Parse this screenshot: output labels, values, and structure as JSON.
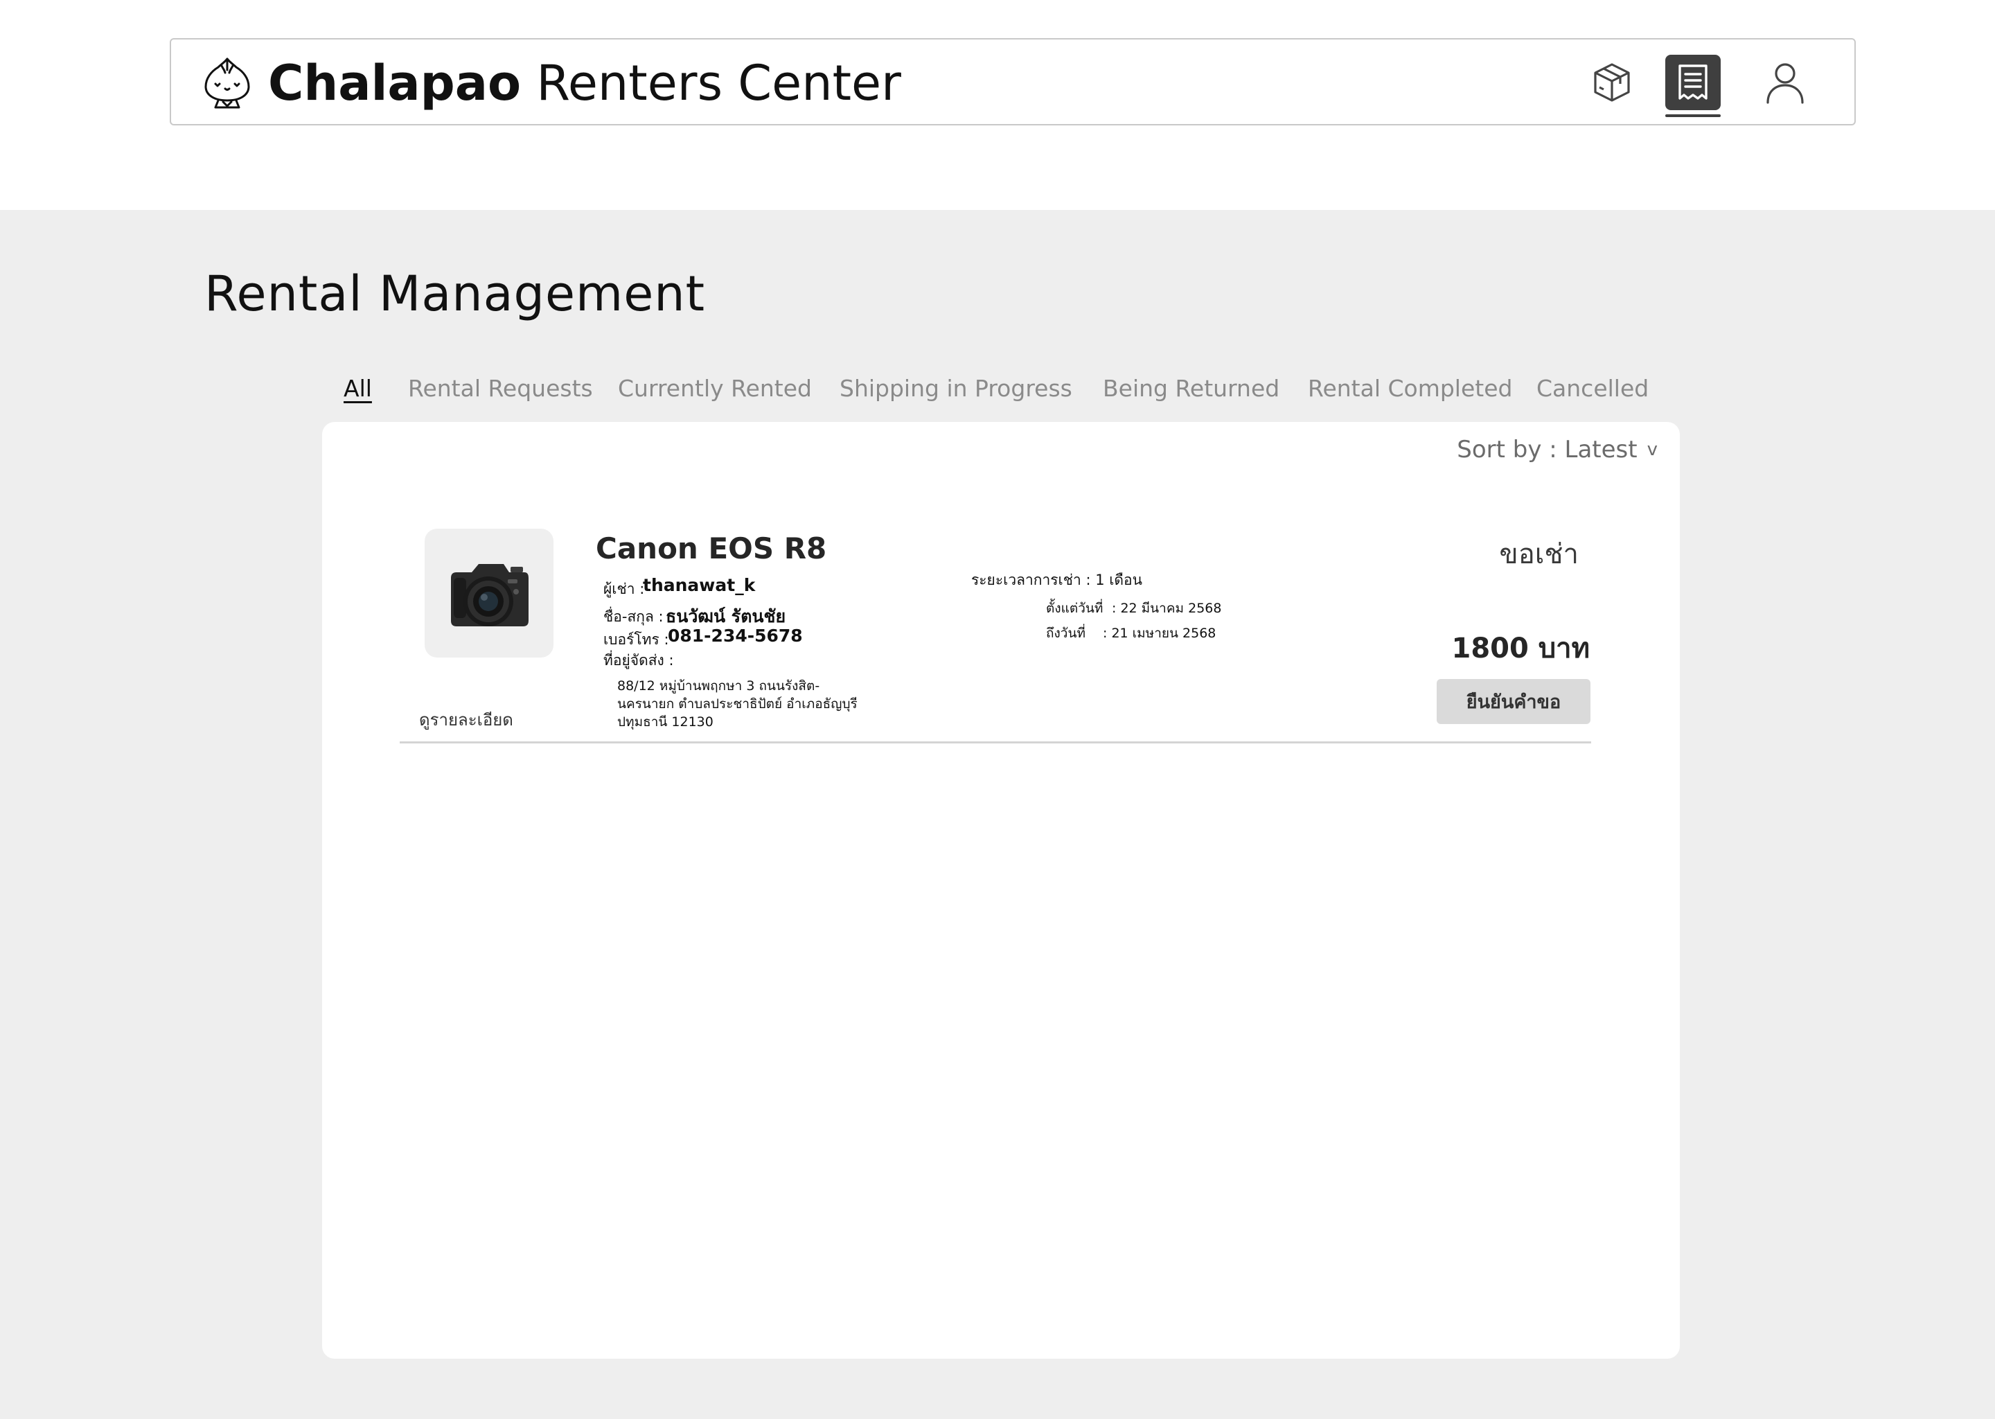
{
  "header": {
    "brand_bold": "Chalapao",
    "brand_rest": " Renters Center",
    "nav": [
      {
        "icon": "package-icon"
      },
      {
        "icon": "receipt-icon",
        "active": true
      },
      {
        "icon": "user-icon"
      }
    ]
  },
  "page": {
    "title": "Rental Management"
  },
  "tabs": [
    {
      "label": "All",
      "active": true
    },
    {
      "label": "Rental Requests"
    },
    {
      "label": "Currently Rented"
    },
    {
      "label": "Shipping in Progress"
    },
    {
      "label": "Being Returned"
    },
    {
      "label": "Rental Completed"
    },
    {
      "label": "Cancelled"
    }
  ],
  "sort": {
    "label": "Sort by : Latest",
    "caret": "v"
  },
  "rental": {
    "product_name": "Canon EOS R8",
    "renter_label": "ผู้เช่า :",
    "renter_value": "thanawat_k",
    "fullname_label": "ชื่อ-สกุล :",
    "fullname_value": "ธนวัฒน์ รัตนชัย",
    "phone_label": "เบอร์โทร :",
    "phone_value": "081-234-5678",
    "address_label": "ที่อยู่จัดส่ง :",
    "address_value": "88/12 หมู่บ้านพฤกษา 3 ถนนรังสิต-นครนายก ตำบลประชาธิปัตย์ อำเภอธัญบุรี ปทุมธานี 12130",
    "period_label": "ระยะเวลาการเช่า : 1 เดือน",
    "from_label": "ตั้งแต่วันที่",
    "from_value": ": 22 มีนาคม 2568",
    "to_label": "ถึงวันที่",
    "to_value": ": 21 เมษายน 2568",
    "status": "ขอเช่า",
    "price": "1800 บาท",
    "confirm_button": "ยืนยันคำขอ",
    "detail_link": "ดูรายละเอียด"
  },
  "colors": {
    "page_bg": "#eeeeee",
    "card_bg": "#ffffff",
    "active_nav": "#3f3f3f",
    "button_bg": "#dadada"
  }
}
